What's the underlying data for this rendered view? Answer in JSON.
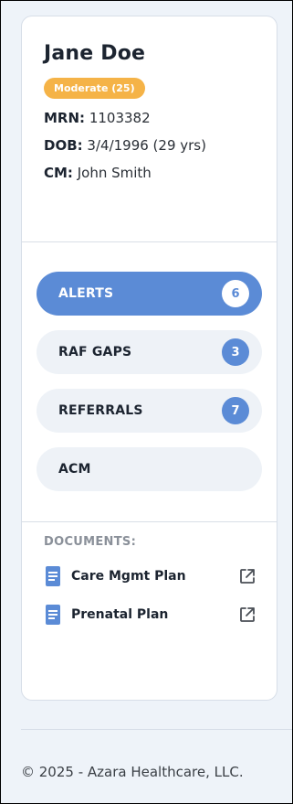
{
  "patient": {
    "name": "Jane Doe",
    "risk_badge": "Moderate (25)",
    "mrn_label": "MRN:",
    "mrn_value": "1103382",
    "dob_label": "DOB:",
    "dob_value": "3/4/1996 (29 yrs)",
    "cm_label": "CM:",
    "cm_value": "John Smith"
  },
  "nav": {
    "items": [
      {
        "label": "ALERTS",
        "count": "6",
        "active": true
      },
      {
        "label": "RAF GAPS",
        "count": "3",
        "active": false
      },
      {
        "label": "REFERRALS",
        "count": "7",
        "active": false
      },
      {
        "label": "ACM",
        "count": "",
        "active": false
      }
    ]
  },
  "documents": {
    "title": "DOCUMENTS:",
    "items": [
      {
        "name": "Care Mgmt Plan",
        "icon": "document-icon",
        "action_icon": "external-link-icon"
      },
      {
        "name": "Prenatal Plan",
        "icon": "document-icon",
        "action_icon": "external-link-icon"
      }
    ]
  },
  "footer": {
    "copyright": "© 2025 - Azara Healthcare, LLC."
  },
  "colors": {
    "accent": "#5b8bd6",
    "risk_badge": "#f5b347",
    "doc_icon": "#5b8bd6"
  }
}
